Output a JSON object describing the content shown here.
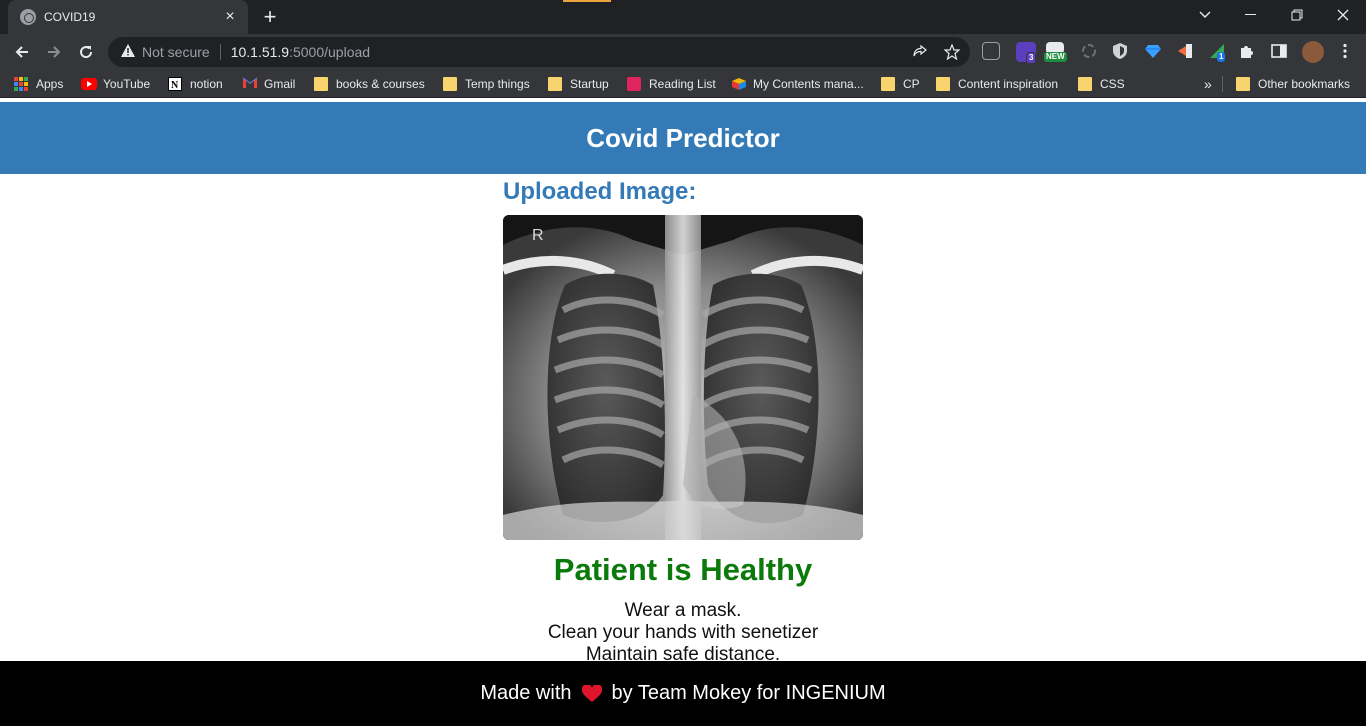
{
  "browser": {
    "tab_title": "COVID19",
    "security_label": "Not secure",
    "url_host": "10.1.51.9",
    "url_path": ":5000/upload",
    "ext_badge_count": "3",
    "ext_badge_new": "NEW",
    "ext_badge_one": "1",
    "bookmarks": [
      {
        "label": "Apps",
        "icon": "apps-grid-icon"
      },
      {
        "label": "YouTube",
        "icon": "youtube-icon"
      },
      {
        "label": "notion",
        "icon": "notion-icon"
      },
      {
        "label": "Gmail",
        "icon": "gmail-icon"
      },
      {
        "label": "books & courses",
        "icon": "folder-icon"
      },
      {
        "label": "Temp things",
        "icon": "folder-icon"
      },
      {
        "label": "Startup",
        "icon": "folder-icon"
      },
      {
        "label": "Reading List",
        "icon": "reading-list-icon"
      },
      {
        "label": "My Contents mana...",
        "icon": "content-icon"
      },
      {
        "label": "CP",
        "icon": "folder-icon"
      },
      {
        "label": "Content inspiration",
        "icon": "folder-icon"
      },
      {
        "label": "CSS",
        "icon": "folder-icon"
      }
    ],
    "overflow_label": "»",
    "other_bookmarks": "Other bookmarks"
  },
  "page": {
    "header_title": "Covid Predictor",
    "uploaded_label": "Uploaded Image:",
    "xray_marker": "R",
    "result_text": "Patient is Healthy",
    "advice": [
      "Wear a mask.",
      "Clean your hands with senetizer",
      "Maintain safe distance."
    ],
    "footer_prefix": "Made with",
    "footer_suffix": "by Team Mokey for INGENIUM"
  },
  "colors": {
    "header_bg": "#337ab7",
    "result_green": "#0a7a0a",
    "heart_red": "#e0142a"
  }
}
